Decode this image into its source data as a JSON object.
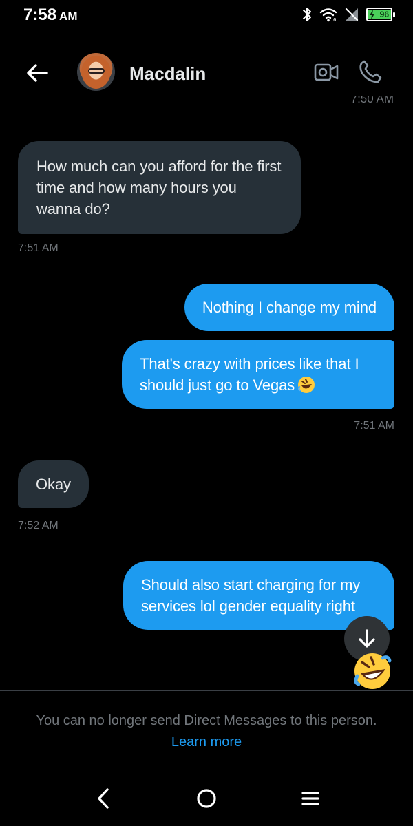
{
  "status_bar": {
    "time": "7:58",
    "ampm": "AM",
    "battery_level": "96",
    "icons": [
      "bluetooth-icon",
      "wifi-icon",
      "no-sim-icon",
      "battery-icon"
    ]
  },
  "header": {
    "contact_name": "Macdalin",
    "icons": [
      "back-arrow-icon",
      "video-call-icon",
      "phone-call-icon"
    ]
  },
  "messages": [
    {
      "direction": "incoming",
      "text": "How much can you afford for the first time and how many hours you wanna do?",
      "timestamp": "7:51 AM"
    },
    {
      "direction": "outgoing",
      "text": "Nothing I change my mind"
    },
    {
      "direction": "outgoing",
      "text": "That's crazy with prices like that I should just go to Vegas",
      "emoji": "rolling-on-floor-laughing",
      "timestamp": "7:51 AM"
    },
    {
      "direction": "incoming",
      "text": "Okay",
      "timestamp": "7:52 AM"
    },
    {
      "direction": "outgoing",
      "text": "Should also start charging for my services lol gender equality right",
      "emoji": "rolling-on-floor-laughing"
    }
  ],
  "partial_timestamp": "7:50 AM",
  "footer": {
    "notice": "You can no longer send Direct Messages to this person.",
    "learn_more": "Learn more"
  },
  "colors": {
    "background": "#000000",
    "incoming_bubble": "#263038",
    "outgoing_bubble": "#1d9bf0",
    "timestamp": "#71767b",
    "link": "#1d9bf0",
    "battery": "#4ad15a"
  }
}
